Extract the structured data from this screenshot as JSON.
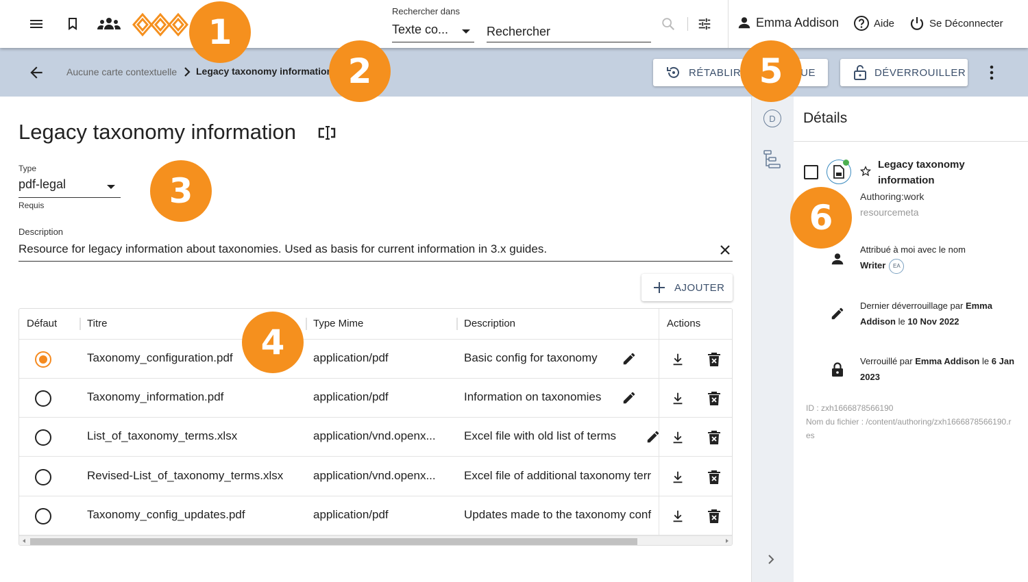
{
  "topbar": {
    "search_label": "Rechercher dans",
    "search_scope": "Texte co...",
    "search_placeholder": "Rechercher",
    "user_name": "Emma Addison",
    "help_label": "Aide",
    "logout_label": "Se Déconnecter"
  },
  "subbar": {
    "crumb_parent": "Aucune carte contextuelle",
    "crumb_current": "Legacy taxonomy information",
    "restore_label": "RÉTABLIR",
    "view_label": "VUE",
    "unlock_label": "DÉVERROUILLER"
  },
  "main": {
    "title": "Legacy taxonomy information",
    "type_label": "Type",
    "type_value": "pdf-legal",
    "type_hint": "Requis",
    "desc_label": "Description",
    "desc_value": "Resource for legacy information about taxonomies. Used as basis for current information in 3.x guides.",
    "add_label": "AJOUTER"
  },
  "table": {
    "headers": {
      "default": "Défaut",
      "title": "Titre",
      "mime": "Type Mime",
      "desc": "Description",
      "actions": "Actions"
    },
    "rows": [
      {
        "title": "Taxonomy_configuration.pdf",
        "mime": "application/pdf",
        "desc": "Basic config for taxonomy",
        "default": true
      },
      {
        "title": "Taxonomy_information.pdf",
        "mime": "application/pdf",
        "desc": "Information on taxonomies",
        "default": false
      },
      {
        "title": "List_of_taxonomy_terms.xlsx",
        "mime": "application/vnd.openx...",
        "desc": "Excel file with old list of terms",
        "default": false
      },
      {
        "title": "Revised-List_of_taxonomy_terms.xlsx",
        "mime": "application/vnd.openx...",
        "desc": "Excel file of additional taxonomy terr",
        "default": false
      },
      {
        "title": "Taxonomy_config_updates.pdf",
        "mime": "application/pdf",
        "desc": "Updates made to the taxonomy conf",
        "default": false
      }
    ]
  },
  "panel": {
    "rail_badge": "D",
    "title": "Détails",
    "item_name": "Legacy taxonomy information",
    "authoring": "Authoring:work",
    "resourcemeta": "resourcemeta",
    "assigned_text": "Attribué à moi avec le nom",
    "assigned_role": "Writer",
    "assigned_badge": "EA",
    "unlock_prefix": "Dernier déverrouillage par",
    "unlock_user": "Emma Addison",
    "unlock_mid": "le",
    "unlock_date": "10 Nov 2022",
    "lock_prefix": "Verrouillé par",
    "lock_user": "Emma Addison",
    "lock_mid": "le",
    "lock_date": "6 Jan 2023",
    "meta_id": "ID : zxh1666878566190",
    "meta_file": "Nom du fichier : /content/authoring/zxh1666878566190.res"
  },
  "callouts": [
    "1",
    "2",
    "3",
    "4",
    "5",
    "6"
  ],
  "colors": {
    "accent": "#f5901e",
    "subbar": "#c4d0e0",
    "button_text": "#3b4f6b"
  }
}
